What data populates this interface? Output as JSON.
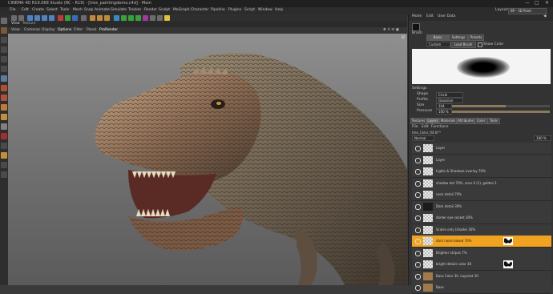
{
  "window": {
    "title": "CINEMA 4D R19.068 Studio (RC - R19) - [trex_paintingdemo.c4d] - Main",
    "minimize": "—",
    "maximize": "□",
    "close": "✕"
  },
  "menubar": {
    "items": [
      "File",
      "Edit",
      "Create",
      "Select",
      "Tools",
      "Mesh",
      "Snap",
      "Animate",
      "Simulate",
      "Tracker",
      "Render",
      "Sculpt",
      "MoGraph",
      "Character",
      "Pipeline",
      "Plugins",
      "Script",
      "Window",
      "Help"
    ],
    "layout_label": "Layout:",
    "layout_value": "BP - 3D Paint"
  },
  "viewport": {
    "tabs": [
      "View",
      "Texture"
    ],
    "menu": [
      "View",
      "Cameras",
      "Display",
      "Options",
      "Filter",
      "Panel",
      "ProRender"
    ],
    "nav_icons": "✥ ⇕ ⟲ ▣"
  },
  "right_panel": {
    "menu": [
      "Mode",
      "Edit",
      "User Data"
    ],
    "back_icon": "◀",
    "tool_label": "Brush",
    "subtabs": [
      "Basic",
      "Settings",
      "Presets"
    ],
    "preset_dropdown": "Custom",
    "load_button": "Load Brush",
    "show_color_label": "Show Color",
    "settings_title": "Settings",
    "params": [
      {
        "label": "Shape",
        "value": "Circle"
      },
      {
        "label": "Profile",
        "value": "Gaussian"
      },
      {
        "label": "Size",
        "value": "104"
      },
      {
        "label": "Pressure",
        "value": "100 %"
      }
    ],
    "size_fill": 0.55,
    "pressure_fill": 1.0,
    "bottom_tabs": [
      "Textures",
      "Layers",
      "Materials",
      "Attributes",
      "Color",
      "Tools"
    ],
    "layers_menu": [
      "File",
      "Edit",
      "Functions"
    ],
    "texture_name": "trex_Color_04.tif *",
    "blend_mode": "Normal",
    "opacity": "100 %",
    "layers": [
      {
        "name": "Layer",
        "thumb": "checker"
      },
      {
        "name": "Layer",
        "thumb": "checker"
      },
      {
        "name": "Lights & Shadows overlay 70%",
        "thumb": "checker"
      },
      {
        "name": "shadow dot 70%, scan 0 (1), golden 1",
        "thumb": "checker"
      },
      {
        "name": "neck detail 70%",
        "thumb": "checker"
      },
      {
        "name": "Dark detail 30%",
        "thumb": "dark"
      },
      {
        "name": "darker eye socket 30%",
        "thumb": "checker"
      },
      {
        "name": "Scales only (shade) 30%",
        "thumb": "checker"
      },
      {
        "name": "dark noise baked 70%",
        "thumb": "checker",
        "selected": true,
        "mask": true
      },
      {
        "name": "Brighter stripes 7%",
        "thumb": "checker"
      },
      {
        "name": "bright details color 30",
        "thumb": "checker",
        "mask": true
      },
      {
        "name": "Base Color 30, Layered 30",
        "thumb": "brown"
      },
      {
        "name": "Base",
        "thumb": "brown"
      }
    ]
  },
  "colors": {
    "selection": "#f0a321",
    "panel": "#333333",
    "viewport_top": "#8f8f8f",
    "viewport_bottom": "#5b5b5b"
  }
}
